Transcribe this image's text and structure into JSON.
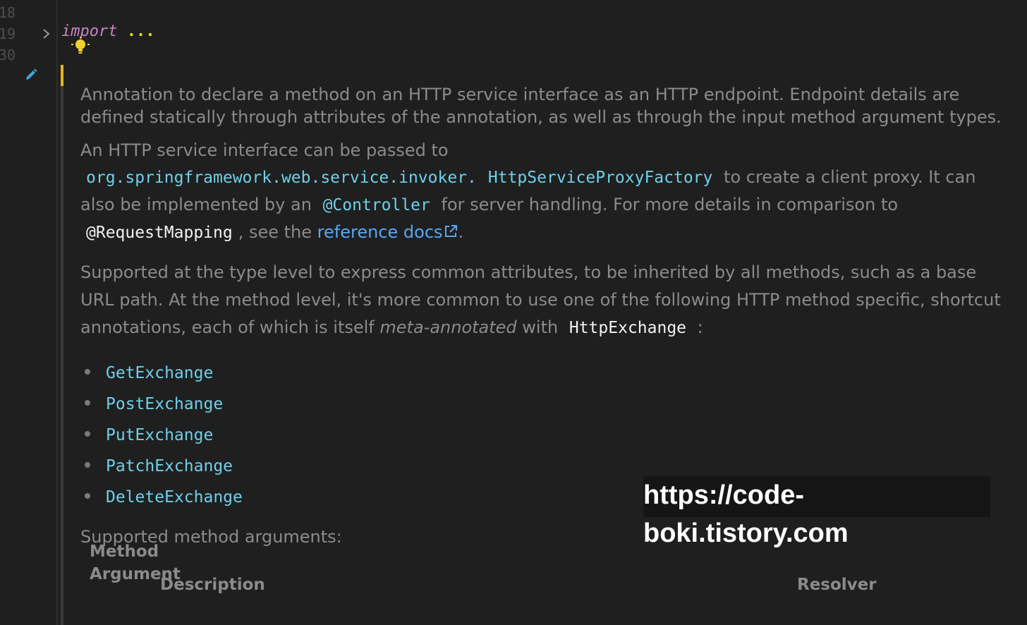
{
  "editor": {
    "line_numbers": [
      "18",
      "19",
      "30"
    ],
    "code": {
      "keyword": "import",
      "ellipsis": "..."
    },
    "icons": {
      "fold": "chevron-right-icon",
      "lightbulb": "lightbulb-icon",
      "edit": "pencil-icon"
    }
  },
  "doc": {
    "para1": "Annotation to declare a method on an HTTP service interface as an HTTP endpoint. Endpoint details are defined statically through attributes of the annotation, as well as through the input method argument types.",
    "para2": {
      "t1": "An HTTP service interface can be passed to",
      "c1": "org.springframework.web.service.invoker.",
      "c2": "HttpServiceProxyFactory",
      "t2": "to create a client proxy. It can also be implemented by an",
      "c3": "@Controller",
      "t3": "for server handling. For more details in comparison to",
      "c4": "@RequestMapping",
      "t4": ", see the",
      "link": "reference docs",
      "t5": "."
    },
    "para3": {
      "t1": "Supported at the type level to express common attributes, to be inherited by all methods, such as a base URL path. At the method level, it's more common to use one of the following HTTP method specific, shortcut annotations, each of which is itself",
      "em": "meta-annotated",
      "t2": "with",
      "c1": "HttpExchange",
      "t3": ":"
    },
    "list": [
      "GetExchange",
      "PostExchange",
      "PutExchange",
      "PatchExchange",
      "DeleteExchange"
    ],
    "para4": "Supported method arguments:",
    "table_headers": [
      "Method Argument",
      "Description",
      "Resolver"
    ]
  },
  "watermark": "https://code-boki.tistory.com",
  "colors": {
    "background": "#1f1f1f",
    "text": "#8b8b8b",
    "link": "#5aa6f2",
    "code_link": "#6fd0ea",
    "accent_bar": "#e6b422"
  }
}
